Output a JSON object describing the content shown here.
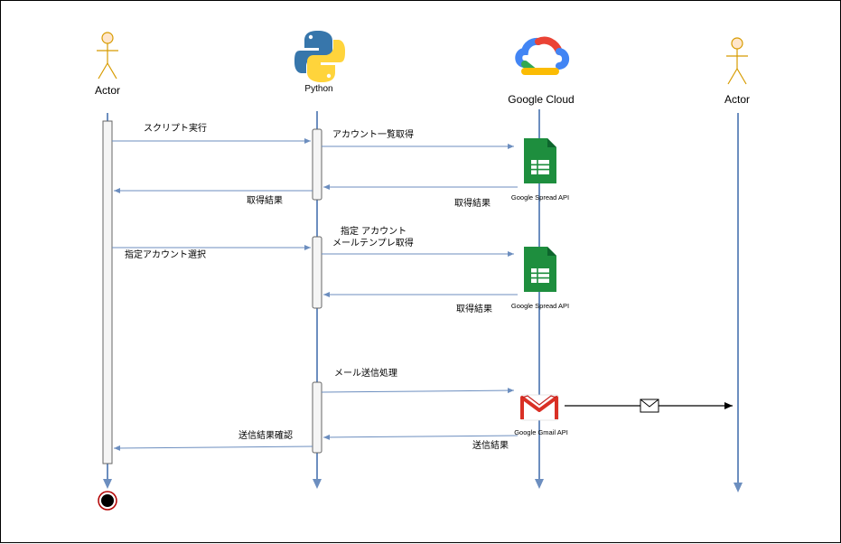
{
  "participants": {
    "actor_left": "Actor",
    "python": "Python",
    "google_cloud": "Google Cloud",
    "actor_right": "Actor"
  },
  "services": {
    "sheets_1": "Google Spread API",
    "sheets_2": "Google Spread API",
    "gmail": "Google Gmail API"
  },
  "messages": {
    "run_script": "スクリプト実行",
    "get_accounts": "アカウント一覧取得",
    "result_sheets_1": "取得結果",
    "result_to_actor": "取得結果",
    "select_account": "指定アカウント選択",
    "get_template_line1": "指定 アカウント",
    "get_template_line2": "メールテンプレ取得",
    "result_sheets_2": "取得結果",
    "send_mail": "メール送信処理",
    "send_result": "送信結果",
    "confirm_result": "送信結果確認"
  },
  "colors": {
    "lifeline": "#6c8ebf",
    "actor_fill": "#ffe6cc",
    "actor_stroke": "#d79b00",
    "sheets_green": "#1e8e3e",
    "gmail_red": "#d93025",
    "end_stroke": "#b20000"
  },
  "icons": [
    "actor-icon",
    "python-icon",
    "google-cloud-icon",
    "sheets-icon",
    "gmail-icon",
    "envelope-icon",
    "end-state-icon"
  ]
}
